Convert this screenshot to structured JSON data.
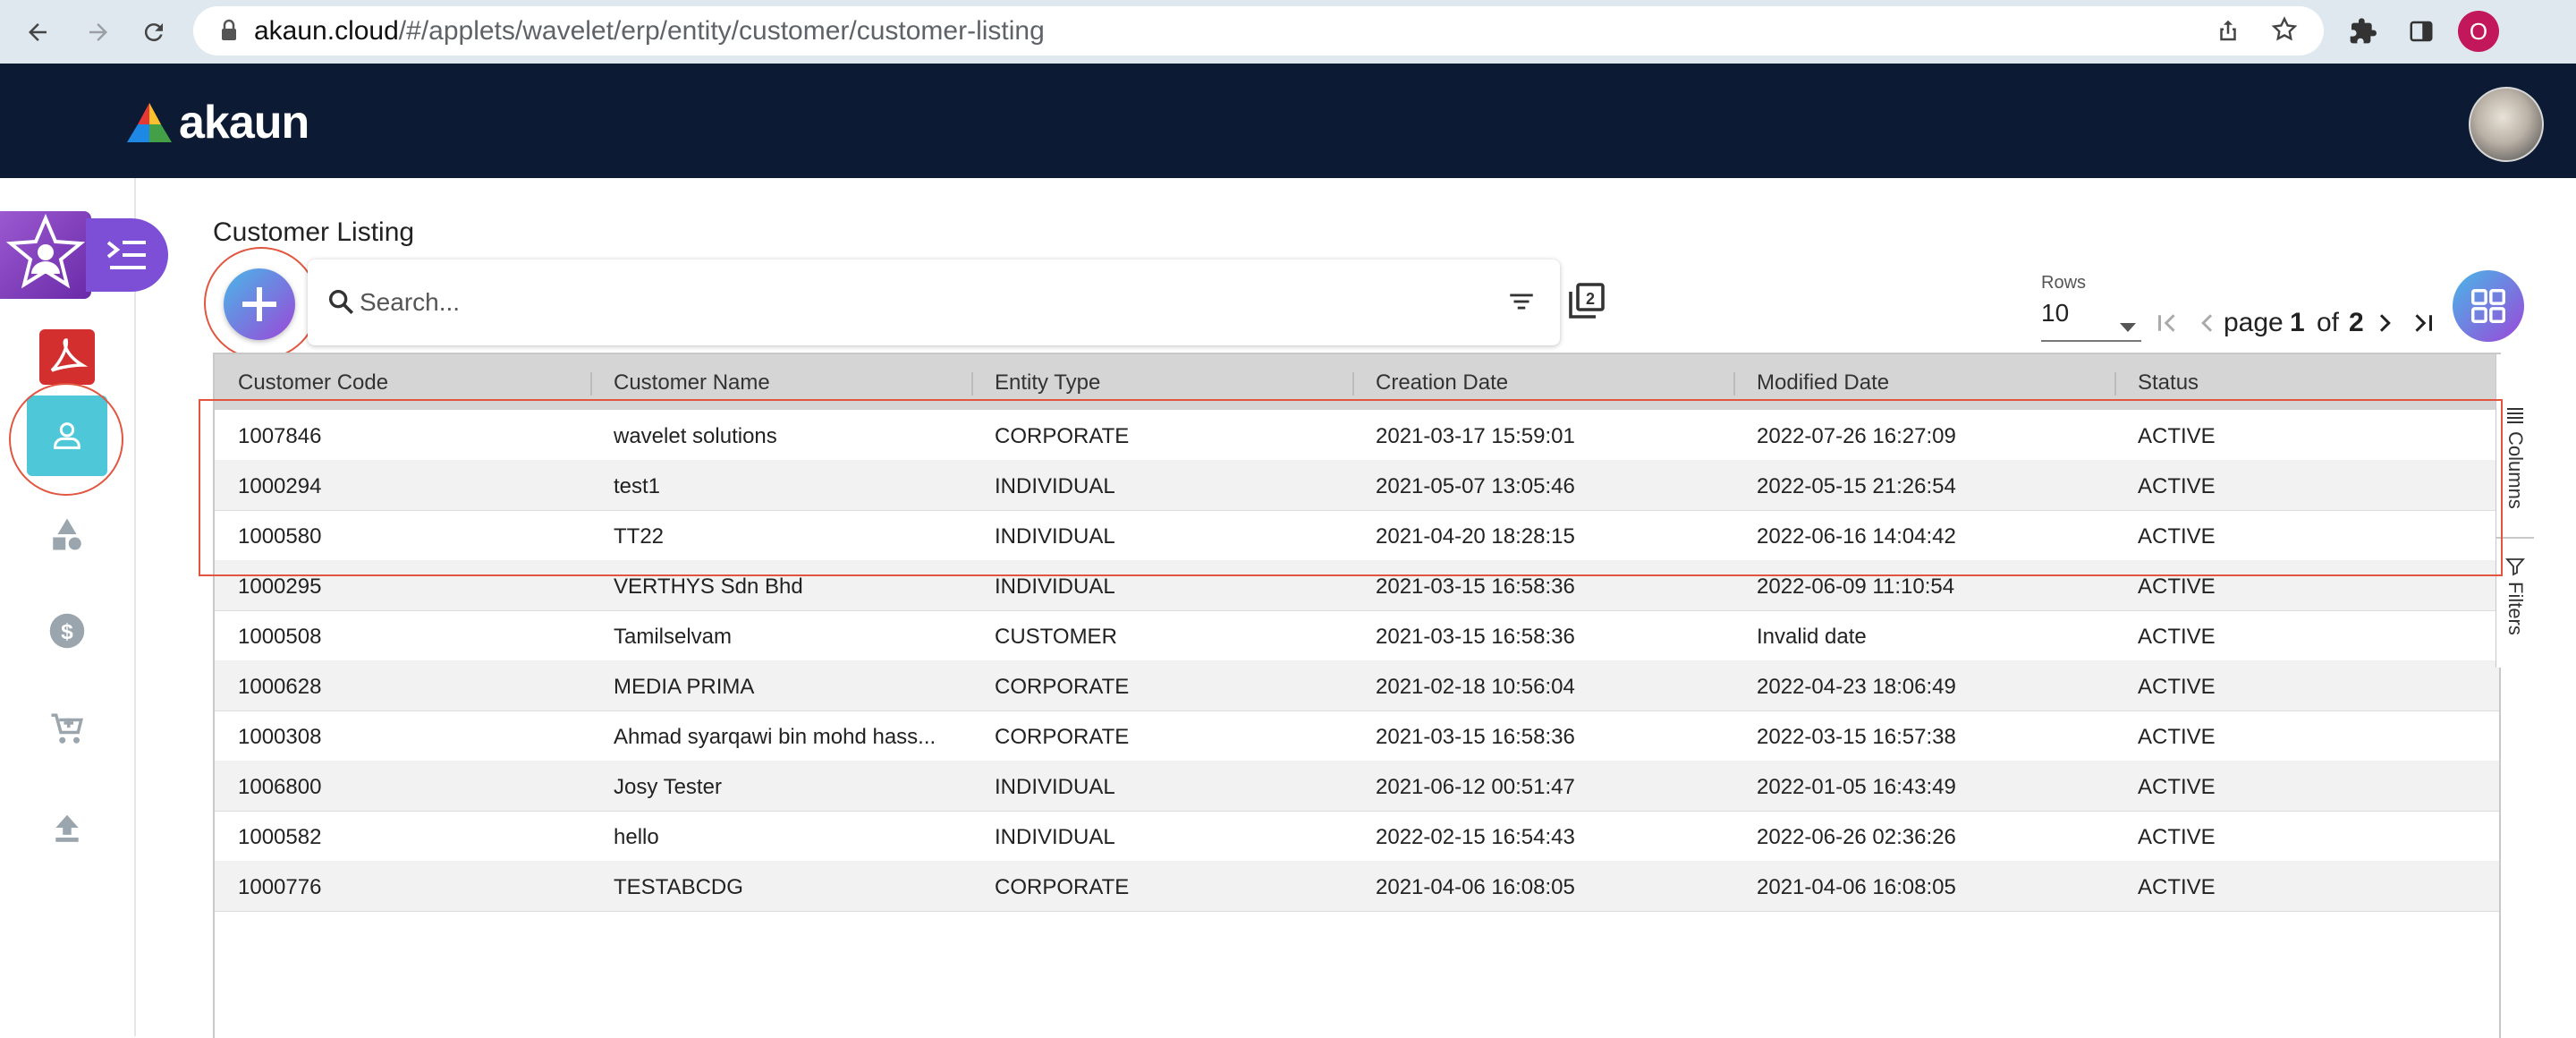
{
  "browser": {
    "url_host": "akaun.cloud",
    "url_path": "/#/applets/wavelet/erp/entity/customer/customer-listing",
    "profile_initial": "O"
  },
  "app": {
    "logo_text": "akaun"
  },
  "page": {
    "title": "Customer Listing"
  },
  "search": {
    "placeholder": "Search..."
  },
  "pagination": {
    "rows_label": "Rows",
    "rows_value": "10",
    "page_label": "page",
    "current_page": "1",
    "of_label": "of",
    "total_pages": "2"
  },
  "side_tabs": {
    "columns": "Columns",
    "filters": "Filters"
  },
  "table": {
    "columns": [
      "Customer Code",
      "Customer Name",
      "Entity Type",
      "Creation Date",
      "Modified Date",
      "Status"
    ],
    "rows": [
      [
        "1007846",
        "wavelet solutions",
        "CORPORATE",
        "2021-03-17 15:59:01",
        "2022-07-26 16:27:09",
        "ACTIVE"
      ],
      [
        "1000294",
        "test1",
        "INDIVIDUAL",
        "2021-05-07 13:05:46",
        "2022-05-15 21:26:54",
        "ACTIVE"
      ],
      [
        "1000580",
        "TT22",
        "INDIVIDUAL",
        "2021-04-20 18:28:15",
        "2022-06-16 14:04:42",
        "ACTIVE"
      ],
      [
        "1000295",
        "VERTHYS Sdn Bhd",
        "INDIVIDUAL",
        "2021-03-15 16:58:36",
        "2022-06-09 11:10:54",
        "ACTIVE"
      ],
      [
        "1000508",
        "Tamilselvam",
        "CUSTOMER",
        "2021-03-15 16:58:36",
        "Invalid date",
        "ACTIVE"
      ],
      [
        "1000628",
        "MEDIA PRIMA",
        "CORPORATE",
        "2021-02-18 10:56:04",
        "2022-04-23 18:06:49",
        "ACTIVE"
      ],
      [
        "1000308",
        "Ahmad syarqawi bin mohd hass...",
        "CORPORATE",
        "2021-03-15 16:58:36",
        "2022-03-15 16:57:38",
        "ACTIVE"
      ],
      [
        "1006800",
        "Josy Tester",
        "INDIVIDUAL",
        "2021-06-12 00:51:47",
        "2022-01-05 16:43:49",
        "ACTIVE"
      ],
      [
        "1000582",
        "hello",
        "INDIVIDUAL",
        "2022-02-15 16:54:43",
        "2022-06-26 02:36:26",
        "ACTIVE"
      ],
      [
        "1000776",
        "TESTABCDG",
        "CORPORATE",
        "2021-04-06 16:08:05",
        "2021-04-06 16:08:05",
        "ACTIVE"
      ]
    ]
  },
  "colors": {
    "header_bg": "#0d1a33",
    "accent_teal": "#4ec7d9",
    "highlight_red": "#e2553f",
    "fab_gradient_start": "#49b7e8",
    "fab_gradient_end": "#9b47d8"
  }
}
